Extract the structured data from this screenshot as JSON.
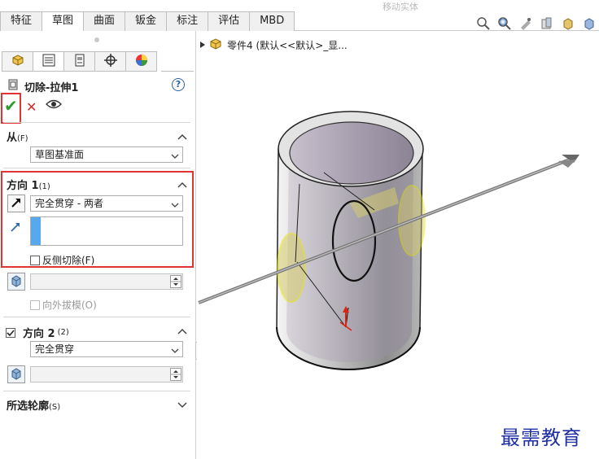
{
  "top_tabs": [
    "特征",
    "草图",
    "曲面",
    "钣金",
    "标注",
    "评估",
    "MBD"
  ],
  "active_top_tab": "草图",
  "top_ghost_text": "移动实体",
  "property_panel": {
    "tabs": [
      "feature-manager-icon",
      "property-manager-icon",
      "configuration-manager-icon",
      "dimxpert-icon",
      "display-manager-icon"
    ],
    "title": "切除-拉伸1",
    "help": "?",
    "from": {
      "heading": "从",
      "shortcut": "(F)",
      "value": "草图基准面"
    },
    "direction1": {
      "heading": "方向 1",
      "shortcut": "(1)",
      "end_condition": "完全贯穿 - 两者",
      "flip_side_label": "反侧切除(F)",
      "flip_side_checked": false,
      "draft_outward_label": "向外拔模(O)"
    },
    "direction2": {
      "heading": "方向 2",
      "shortcut": "(2)",
      "checked": true,
      "end_condition": "完全贯穿"
    },
    "selected_contours": {
      "heading": "所选轮廓",
      "shortcut": "(S)"
    }
  },
  "tree": {
    "part_label": "零件4  (默认<<默认>_显..."
  },
  "watermark": "最需教育",
  "colors": {
    "highlight_red": "#e03434",
    "ok_green": "#2e9b2e",
    "cancel_red": "#d42a2a",
    "selection_blue": "#56a9ef",
    "sketch_yellow": "#e6e600"
  }
}
